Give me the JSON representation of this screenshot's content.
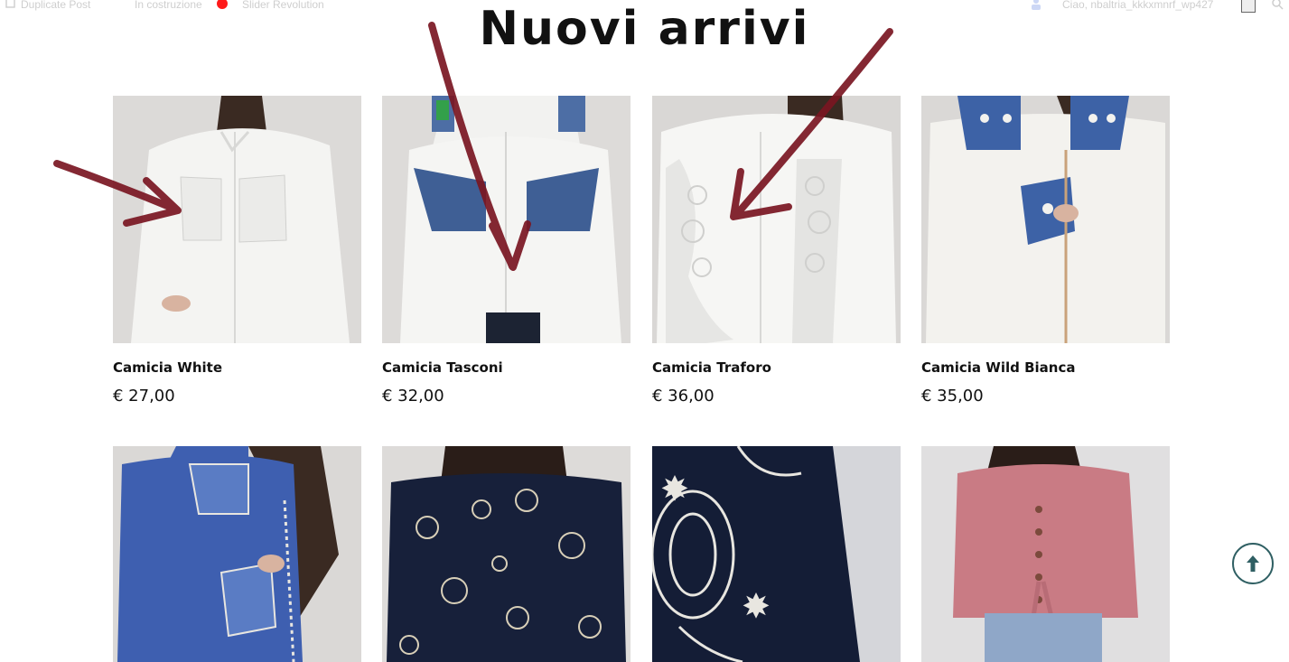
{
  "adminbar": {
    "duplicate_post": "Duplicate Post",
    "in_costruzione": "In costruzione",
    "slider_revolution": "Slider Revolution",
    "greeting": "Ciao, nbaltria_kkkxmnrf_wp427"
  },
  "section": {
    "title": "Nuovi arrivi"
  },
  "products": [
    {
      "name": "Camicia White",
      "price": "€ 27,00"
    },
    {
      "name": "Camicia Tasconi",
      "price": "€ 32,00"
    },
    {
      "name": "Camicia Traforo",
      "price": "€ 36,00"
    },
    {
      "name": "Camicia Wild Bianca",
      "price": "€ 35,00"
    }
  ],
  "colors": {
    "arrow": "#7a1622",
    "scroll_top_border": "#2f5f63",
    "status_dot": "#ff1a1a"
  },
  "icons": {
    "scroll_top": "arrow-up-icon",
    "duplicate": "copy-icon",
    "user": "user-icon",
    "search": "search-icon"
  }
}
